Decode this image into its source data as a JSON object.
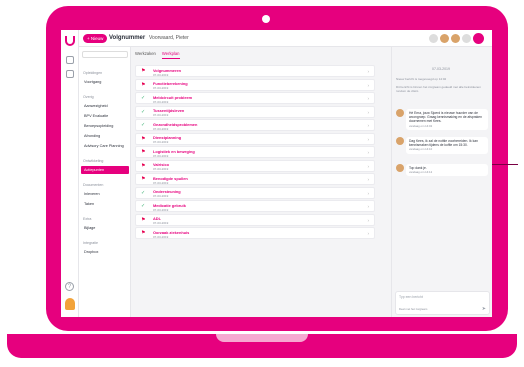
{
  "header": {
    "new_button": "+ Nieuw",
    "case_title": "Volgnummer",
    "user_name": "Voorwaard, Pieter"
  },
  "nav": {
    "select_value": "",
    "sections": [
      {
        "heading": "Opleidingen",
        "items": [
          {
            "label": "Voortgang",
            "active": false
          }
        ]
      },
      {
        "heading": "Overig",
        "items": [
          {
            "label": "Aanwezigheid",
            "active": false
          },
          {
            "label": "BPV Evaluatie",
            "active": false
          },
          {
            "label": "Beroepsopleiding",
            "active": false
          },
          {
            "label": "Afronding",
            "active": false
          },
          {
            "label": "Advisory Care Planning",
            "active": false
          }
        ]
      },
      {
        "heading": "Ontwikkeling",
        "items": [
          {
            "label": "Actiepunten",
            "active": true
          }
        ]
      },
      {
        "heading": "Documenten",
        "items": [
          {
            "label": "Inleveren",
            "active": false
          },
          {
            "label": "Taken",
            "active": false
          }
        ]
      },
      {
        "heading": "Extra",
        "items": [
          {
            "label": "Bijlage",
            "active": false
          }
        ]
      },
      {
        "heading": "Integratie",
        "items": [
          {
            "label": "Dropbox",
            "active": false
          }
        ]
      }
    ]
  },
  "main": {
    "tabs": [
      {
        "label": "Werkzaken",
        "active": false
      },
      {
        "label": "Werkplan",
        "active": true
      }
    ],
    "rows": [
      {
        "title": "Volgnummeren",
        "date": "07-03-2019",
        "status": "flag"
      },
      {
        "title": "Functieberekening",
        "date": "07-03-2019",
        "status": "flag"
      },
      {
        "title": "Meldcircuit probleem",
        "date": "07-03-2019",
        "status": "ok"
      },
      {
        "title": "Tussentijdsleven",
        "date": "07-03-2019",
        "status": "ok"
      },
      {
        "title": "Gezondheidsproblemen",
        "date": "07-03-2019",
        "status": "ok"
      },
      {
        "title": "Dienstplanning",
        "date": "07-03-2019",
        "status": "flag"
      },
      {
        "title": "Logistiek en beweging",
        "date": "07-03-2019",
        "status": "flag"
      },
      {
        "title": "Valrisico",
        "date": "07-03-2019",
        "status": "flag"
      },
      {
        "title": "Benodigde spullen",
        "date": "07-03-2019",
        "status": "flag"
      },
      {
        "title": "Ondersteuning",
        "date": "07-03-2019",
        "status": "ok"
      },
      {
        "title": "Medicatie gebruik",
        "date": "07-03-2019",
        "status": "ok"
      },
      {
        "title": "ADL",
        "date": "07-03-2019",
        "status": "flag"
      },
      {
        "title": "Oorzaak ziekenhuis",
        "date": "07-03-2019",
        "status": "flag"
      }
    ]
  },
  "chat": {
    "date": "07-03-2019",
    "system_lines": [
      "Nieuw bericht is toegevoegd op 14:02",
      "Dit bericht is binnen het zorgteam gedeeld met alle betrokkenen rondom de cliënt."
    ],
    "messages": [
      {
        "text": "Hé Erna, jouw Sjoerd is nieuwe huurder van de woongroep. Graag kennismaking en de afspraken doornemen met Kees.",
        "time": "vandaag om 14:02"
      },
      {
        "text": "Dag Kees, ik zal de notitie voorbereiden. Ik kan kennismaken tijdens de koffie om 15:30.",
        "time": "vandaag om 14:10"
      },
      {
        "text": "Top dank je.",
        "time": "vandaag om 14:12"
      }
    ],
    "composer_placeholder": "Typ een bericht",
    "composer_option": "Deel met het zorgteam"
  },
  "colors": {
    "brand": "#e6007e",
    "ok": "#3bb273",
    "flag": "#e60050"
  }
}
